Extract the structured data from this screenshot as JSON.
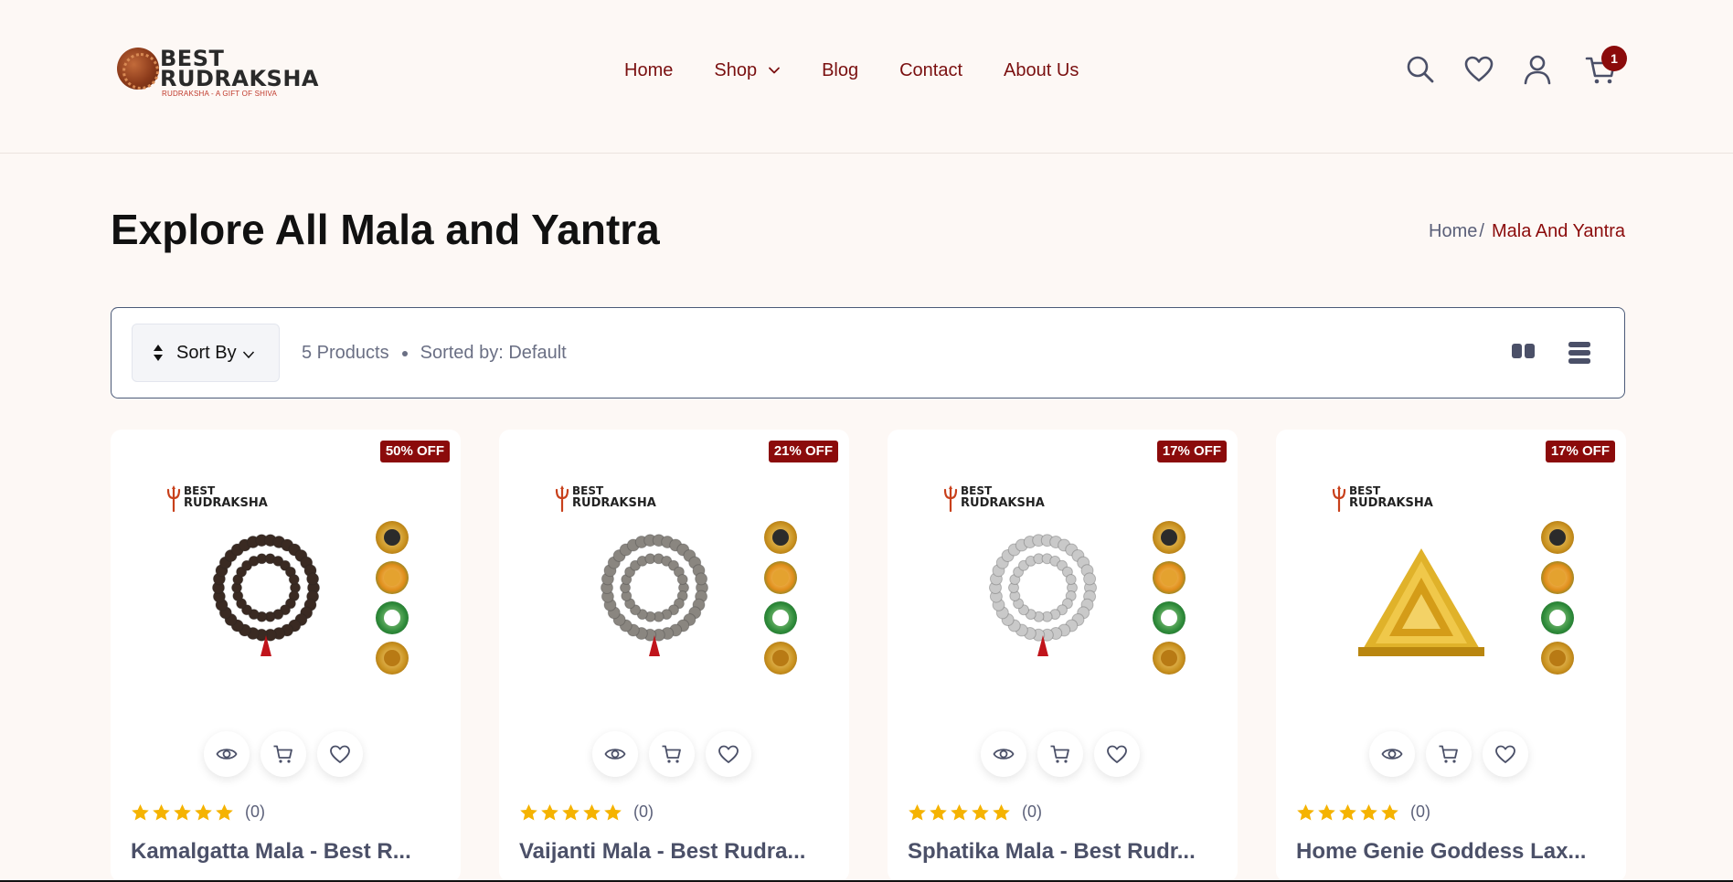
{
  "brand": {
    "line1": "BEST",
    "line2": "RUDRAKSHA",
    "tagline": "RUDRAKSHA - A GIFT OF SHIVA",
    "accent": "#8b0b0b"
  },
  "nav": {
    "items": [
      {
        "label": "Home"
      },
      {
        "label": "Shop",
        "has_dropdown": true
      },
      {
        "label": "Blog"
      },
      {
        "label": "Contact"
      },
      {
        "label": "About Us"
      }
    ]
  },
  "header_icons": {
    "search": "search-icon",
    "wishlist": "heart-icon",
    "account": "user-icon",
    "cart": "cart-icon",
    "cart_count": "1"
  },
  "page": {
    "title": "Explore All Mala and Yantra",
    "breadcrumb": {
      "home": "Home",
      "separator": "/",
      "current": "Mala And Yantra"
    }
  },
  "toolbar": {
    "sort_label": "Sort By",
    "product_count": "5 Products",
    "sorted_by": "Sorted by: Default",
    "view_grid": "grid-view-icon",
    "view_list": "list-view-icon"
  },
  "products": [
    {
      "name": "Kamalgatta Mala - Best R...",
      "discount": "50% OFF",
      "rating_count": "(0)",
      "stars": 5,
      "bead_color": "#3a2a22",
      "image": "kamalgatta-mala"
    },
    {
      "name": "Vaijanti Mala - Best Rudra...",
      "discount": "21% OFF",
      "rating_count": "(0)",
      "stars": 5,
      "bead_color": "#8a8680",
      "image": "vaijanti-mala"
    },
    {
      "name": "Sphatika Mala - Best Rudr...",
      "discount": "17% OFF",
      "rating_count": "(0)",
      "stars": 5,
      "bead_color": "#c9c9c9",
      "image": "sphatika-mala"
    },
    {
      "name": "Home Genie Goddess Lax...",
      "discount": "17% OFF",
      "rating_count": "(0)",
      "stars": 5,
      "bead_color": "#d6a21e",
      "image": "shri-yantra"
    }
  ],
  "product_image_brand": {
    "line1": "BEST",
    "line2": "RUDRAKSHA"
  },
  "colors": {
    "star": "#f5b301",
    "badge": "#8b0b0b",
    "nav_text": "#7a1010"
  }
}
